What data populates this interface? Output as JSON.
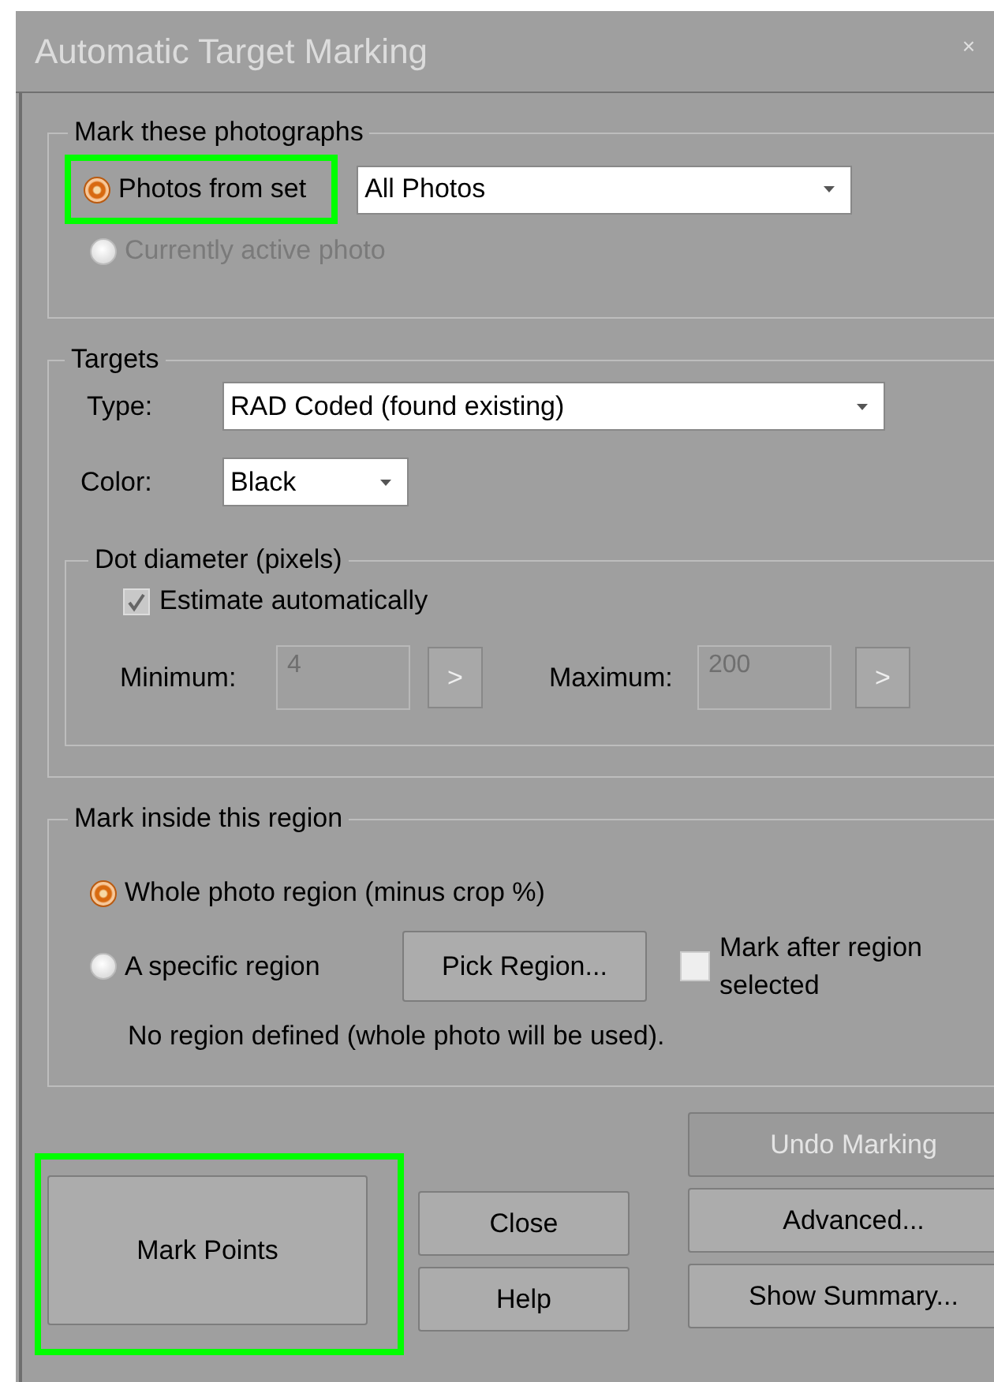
{
  "window": {
    "title": "Automatic Target Marking",
    "close_glyph": "×"
  },
  "photos_group": {
    "title": "Mark these photographs",
    "options": [
      {
        "label": "Photos from set",
        "selected": true,
        "disabled": false,
        "highlighted": true
      },
      {
        "label": "Currently active photo",
        "selected": false,
        "disabled": true,
        "highlighted": false
      }
    ],
    "set_dropdown": {
      "value": "All Photos"
    }
  },
  "targets_group": {
    "title": "Targets",
    "type": {
      "label": "Type:",
      "value": "RAD Coded (found existing)"
    },
    "color": {
      "label": "Color:",
      "value": "Black"
    },
    "dot_diameter": {
      "title": "Dot diameter (pixels)",
      "estimate": {
        "label": "Estimate automatically",
        "checked": true,
        "disabled": true
      },
      "minimum": {
        "label": "Minimum:",
        "value": "4",
        "button": ">"
      },
      "maximum": {
        "label": "Maximum:",
        "value": "200",
        "button": ">"
      }
    }
  },
  "region_group": {
    "title": "Mark inside this region",
    "options": [
      {
        "label": "Whole photo region (minus crop %)",
        "selected": true
      },
      {
        "label": "A specific region",
        "selected": false
      }
    ],
    "pick_button": "Pick Region...",
    "mark_after": {
      "label": "Mark after region selected",
      "checked": false
    },
    "note": "No region defined (whole photo will be used)."
  },
  "buttons": {
    "mark_points": {
      "label": "Mark Points",
      "highlighted": true
    },
    "close": {
      "label": "Close"
    },
    "help": {
      "label": "Help"
    },
    "undo": {
      "label": "Undo Marking",
      "disabled": true
    },
    "advanced": {
      "label": "Advanced..."
    },
    "summary": {
      "label": "Show Summary..."
    }
  }
}
